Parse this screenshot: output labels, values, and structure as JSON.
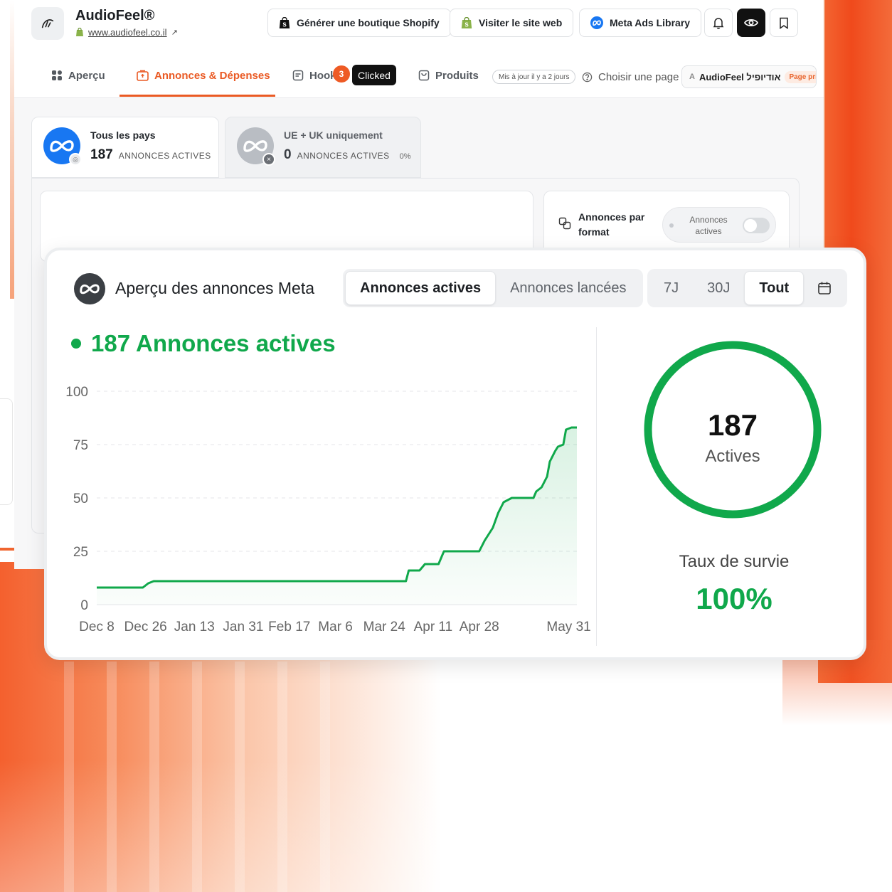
{
  "app": {
    "brand_name": "AudioFeel®",
    "brand_url": "www.audiofeel.co.il"
  },
  "header": {
    "btn_shopify": "Générer une boutique Shopify",
    "btn_website": "Visiter le site web",
    "btn_meta_library": "Meta Ads Library"
  },
  "nav": {
    "items": [
      {
        "label": "Aperçu"
      },
      {
        "label": "Annonces & Dépenses"
      },
      {
        "label": "Hook"
      },
      {
        "label": "Produits"
      }
    ],
    "hook_badge": "3",
    "clicked_tooltip": "Clicked",
    "updated": "Mis à jour il y a 2 jours",
    "choose_page": "Choisir une page",
    "page_avatar": "A",
    "page_name": "AudioFeel אודיופיל",
    "page_tag": "Page principale"
  },
  "countries": [
    {
      "name": "Tous les pays",
      "count": "187",
      "label": "ANNONCES ACTIVES",
      "pct": ""
    },
    {
      "name": "UE + UK uniquement",
      "count": "0",
      "label": "ANNONCES ACTIVES",
      "pct": "0%"
    }
  ],
  "format_card": {
    "title": "Annonces par format",
    "toggle_label": "Annonces actives"
  },
  "overview": {
    "title": "Aperçu des annonces Meta",
    "tabs": [
      "Annonces actives",
      "Annonces lancées"
    ],
    "selected_tab": "Annonces actives",
    "ranges": [
      "7J",
      "30J",
      "Tout"
    ],
    "selected_range": "Tout",
    "active_heading": "187 Annonces actives",
    "ring_value": "187",
    "ring_label": "Actives",
    "ring_fraction": 1.0,
    "survival_label": "Taux de survie",
    "survival_value": "100%"
  },
  "colors": {
    "accent": "#ea5a24",
    "green": "#10a84b",
    "meta_blue": "#1877f2"
  },
  "chart_data": {
    "type": "area",
    "y_ticks": [
      0,
      25,
      50,
      75,
      100
    ],
    "ylim": [
      0,
      100
    ],
    "x_tick_labels": [
      "Dec 8",
      "Dec 26",
      "Jan 13",
      "Jan 31",
      "Feb 17",
      "Mar 6",
      "Mar 24",
      "Apr 11",
      "Apr 28",
      "May 31"
    ],
    "x_tick_days": [
      0,
      18,
      36,
      54,
      71,
      88,
      106,
      124,
      141,
      174
    ],
    "xlim": [
      0,
      177
    ],
    "grid": true,
    "series": [
      {
        "points": [
          [
            0,
            8
          ],
          [
            17,
            8
          ],
          [
            19,
            10
          ],
          [
            21,
            11
          ],
          [
            30,
            11
          ],
          [
            60,
            11
          ],
          [
            90,
            11
          ],
          [
            114,
            11
          ],
          [
            115,
            16
          ],
          [
            119,
            16
          ],
          [
            121,
            19
          ],
          [
            126,
            19
          ],
          [
            128,
            25
          ],
          [
            141,
            25
          ],
          [
            143,
            30
          ],
          [
            146,
            36
          ],
          [
            148,
            43
          ],
          [
            150,
            48
          ],
          [
            153,
            50
          ],
          [
            161,
            50
          ],
          [
            162,
            53
          ],
          [
            164,
            55
          ],
          [
            166,
            60
          ],
          [
            167,
            67
          ],
          [
            169,
            72
          ],
          [
            170,
            74
          ],
          [
            172,
            75
          ],
          [
            173,
            82
          ],
          [
            175,
            83
          ],
          [
            177,
            83
          ]
        ]
      }
    ]
  }
}
